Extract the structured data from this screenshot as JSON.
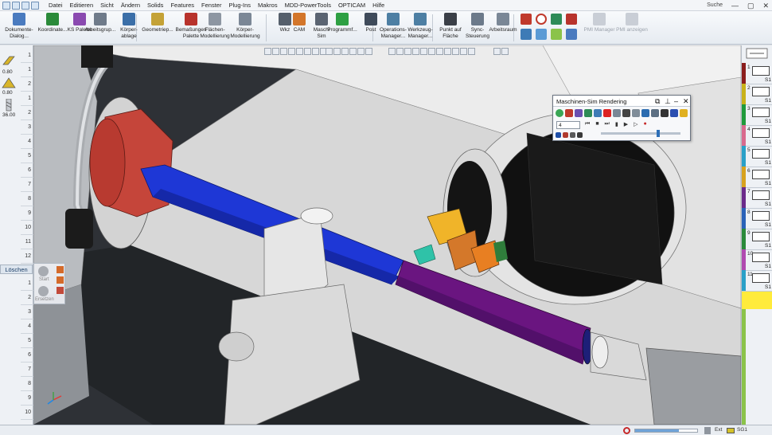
{
  "menubar": {
    "items": [
      "Datei",
      "Editieren",
      "Sicht",
      "Ändern",
      "Solids",
      "Features",
      "Fenster",
      "Plug-Ins",
      "Makros",
      "MDD-PowerTools",
      "OPTICAM",
      "Hilfe"
    ],
    "search": "Suche"
  },
  "ribbon": {
    "buttons": [
      {
        "label1": "Dokumente-",
        "label2": "Dialog...",
        "icon": "document-icon",
        "color": "#4a7bbf"
      },
      {
        "label1": "Koordinate...",
        "label2": "",
        "icon": "coordinates-icon",
        "color": "#2a8a3a"
      },
      {
        "label1": "KS Palette",
        "label2": "",
        "icon": "cs-palette-icon",
        "color": "#8a4ab0"
      },
      {
        "label1": "Arbeitsgrup...",
        "label2": "",
        "icon": "workgroup-icon",
        "color": "#6f7b8a"
      },
      {
        "label1": "Körper-",
        "label2": "ablage",
        "icon": "body-storage-icon",
        "color": "#3b6fa8"
      },
      {
        "label1": "Geometriep...",
        "label2": "",
        "icon": "geometry-palette-icon",
        "color": "#c4a236"
      },
      {
        "label1": "Bemaßungen",
        "label2": "Palette",
        "icon": "dimension-palette-icon",
        "color": "#b8332c"
      },
      {
        "label1": "Flächen-",
        "label2": "Modellierung",
        "icon": "surface-modeling-icon",
        "color": "#8d96a2"
      },
      {
        "label1": "Körper-",
        "label2": "Modellierung",
        "icon": "solid-modeling-icon",
        "color": "#7b8796"
      },
      {
        "label1": "Wkz",
        "label2": "",
        "icon": "tool-icon",
        "color": "#555f6b"
      },
      {
        "label1": "CAM",
        "label2": "",
        "icon": "cam-icon",
        "color": "#d3762a"
      },
      {
        "label1": "Maschi",
        "label2": "Sim",
        "icon": "machine-sim-icon",
        "color": "#5a6472"
      },
      {
        "label1": "Programmf...",
        "label2": "",
        "icon": "program-check-icon",
        "color": "#2ea043"
      },
      {
        "label1": "Post",
        "label2": "",
        "icon": "post-icon",
        "color": "#3f4b5a"
      },
      {
        "label1": "Operations-",
        "label2": "Manager...",
        "icon": "operations-manager-icon",
        "color": "#4d7fa3"
      },
      {
        "label1": "Werkzeug-",
        "label2": "Manager...",
        "icon": "tool-manager-icon",
        "color": "#4d7fa3"
      },
      {
        "label1": "Punkt auf",
        "label2": "Fläche",
        "icon": "point-on-surface-icon",
        "color": "#3a3f47"
      },
      {
        "label1": "Sync-",
        "label2": "Steuerung",
        "icon": "sync-control-icon",
        "color": "#6c7a8a"
      },
      {
        "label1": "Arbeitsraum",
        "label2": "",
        "icon": "workspace-icon",
        "color": "#7a8796"
      }
    ],
    "pmi_manager": "PMI Manager",
    "pmi_show": "PMI anzeigen"
  },
  "left_panel": {
    "values": [
      "0.80",
      "0.80",
      "36.00"
    ],
    "ruler": [
      "1",
      "1",
      "2",
      "1",
      "2",
      "3",
      "4",
      "5",
      "6",
      "7",
      "8",
      "9",
      "10",
      "11",
      "12"
    ],
    "delete_label": "Löschen",
    "ruler2": [
      "1",
      "2",
      "3",
      "4",
      "5",
      "6",
      "7",
      "8",
      "9",
      "10"
    ],
    "mini_start": "Start",
    "mini_replace": "Ersetzen"
  },
  "right_panel": {
    "slots": [
      {
        "num": "1",
        "color": "#8a1d1d",
        "label": "S1"
      },
      {
        "num": "2",
        "color": "#c9b21a",
        "label": "S1"
      },
      {
        "num": "3",
        "color": "#1f9a3c",
        "label": "S1"
      },
      {
        "num": "4",
        "color": "#d96a8e",
        "label": "S1"
      },
      {
        "num": "5",
        "color": "#2aa0c8",
        "label": "S1"
      },
      {
        "num": "6",
        "color": "#d8a21e",
        "label": "S1"
      },
      {
        "num": "7",
        "color": "#6a2a8a",
        "label": "S1"
      },
      {
        "num": "8",
        "color": "#2a62b8",
        "label": "S1"
      },
      {
        "num": "9",
        "color": "#2a8a3a",
        "label": "S1"
      },
      {
        "num": "10",
        "color": "#b04ab0",
        "label": "S1"
      },
      {
        "num": "11",
        "color": "#2aa0c8",
        "label": "S1"
      }
    ]
  },
  "sim_panel": {
    "title": "Maschinen-Sim Rendering",
    "input_value": "4"
  },
  "statusbar": {
    "label_ext": "Ext",
    "label_sg": "SG1",
    "progress": 0.7
  },
  "colors": {
    "workpiece_blue": "#1e37d6",
    "workpiece_purple": "#6a1580",
    "chuck_red": "#c5453a",
    "machine_gray": "#e8e8e8",
    "accent": "#2d6fb7"
  }
}
